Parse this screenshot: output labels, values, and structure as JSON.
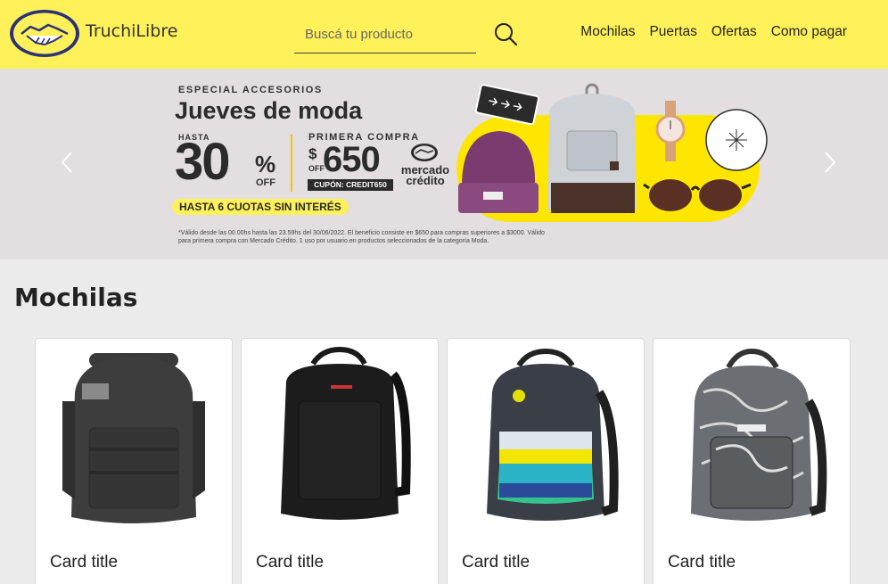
{
  "header": {
    "brand": "TruchiLibre",
    "search_placeholder": "Buscá tu producto",
    "nav": [
      "Mochilas",
      "Puertas",
      "Ofertas",
      "Como pagar"
    ]
  },
  "banner": {
    "eyebrow": "ESPECIAL ACCESORIOS",
    "title": "Jueves de moda",
    "hasta": "HASTA",
    "discount": "30",
    "percent": "%",
    "off": "OFF",
    "primera": "PRIMERA COMPRA",
    "dollar": "$",
    "amount": "650",
    "off2": "OFF",
    "coupon": "CUPÓN: CREDIT650",
    "credit_brand": "mercado crédito",
    "cuotas": "HASTA 6 CUOTAS SIN INTERÉS",
    "legal": "*Válido desde las 00.00hs hasta las 23.59hs del 30/06/2022. El beneficio consiste en $650 para compras superiores a $3000. Válido para primera compra con Mercado Crédito. 1 uso por usuario.en productos seleccionados de la categoría Moda."
  },
  "section": {
    "title": "Mochilas"
  },
  "cards": [
    {
      "title": "Card title"
    },
    {
      "title": "Card title"
    },
    {
      "title": "Card title"
    },
    {
      "title": "Card title"
    }
  ],
  "colors": {
    "header_bg": "#fff159",
    "banner_bg": "#e3dedf",
    "page_bg": "#ebebeb",
    "text": "#222222"
  }
}
